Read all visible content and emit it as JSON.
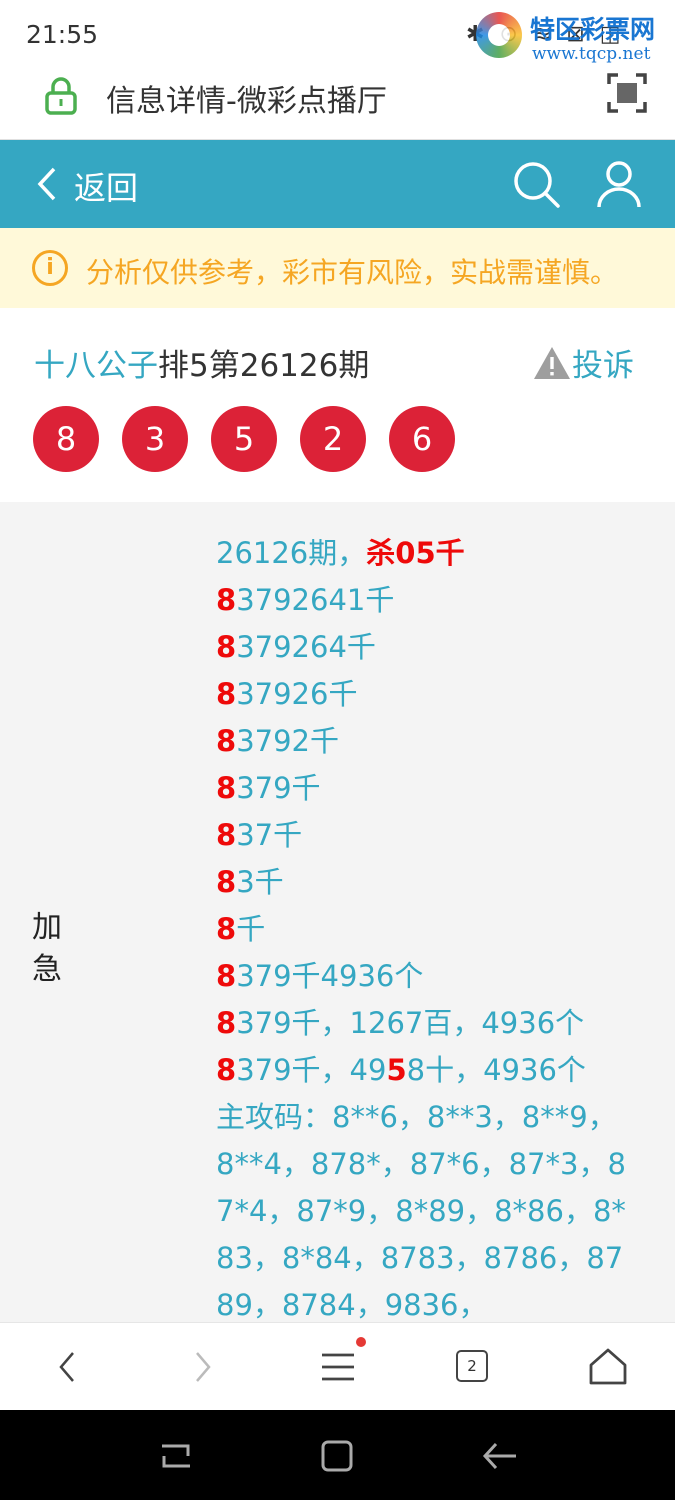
{
  "status_bar": {
    "time": "21:55",
    "icons": "✱ ⊙ ≋ ⊠ ◫"
  },
  "watermark": {
    "title": "特区彩票网",
    "url": "www.tqcp.net"
  },
  "address_bar": {
    "title": "信息详情-微彩点播厅"
  },
  "header": {
    "back_label": "返回"
  },
  "notice": {
    "text": "分析仅供参考，彩市有风险，实战需谨慎。"
  },
  "issue": {
    "author": "十八公子",
    "title_rest": "排5第26126期",
    "report_label": "投诉",
    "balls": [
      "8",
      "3",
      "5",
      "2",
      "6"
    ]
  },
  "content": {
    "side_label": "加急",
    "lines": [
      [
        {
          "t": "26126期，",
          "h": false
        },
        {
          "t": "杀05千",
          "h": true
        }
      ],
      [
        {
          "t": "8",
          "h": true
        },
        {
          "t": "3792641千",
          "h": false
        }
      ],
      [
        {
          "t": "8",
          "h": true
        },
        {
          "t": "379264千",
          "h": false
        }
      ],
      [
        {
          "t": "8",
          "h": true
        },
        {
          "t": "37926千",
          "h": false
        }
      ],
      [
        {
          "t": "8",
          "h": true
        },
        {
          "t": "3792千",
          "h": false
        }
      ],
      [
        {
          "t": "8",
          "h": true
        },
        {
          "t": "379千",
          "h": false
        }
      ],
      [
        {
          "t": "8",
          "h": true
        },
        {
          "t": "37千",
          "h": false
        }
      ],
      [
        {
          "t": "8",
          "h": true
        },
        {
          "t": "3千",
          "h": false
        }
      ],
      [
        {
          "t": "8",
          "h": true
        },
        {
          "t": "千",
          "h": false
        }
      ],
      [
        {
          "t": "8",
          "h": true
        },
        {
          "t": "379千4936个",
          "h": false
        }
      ],
      [
        {
          "t": "8",
          "h": true
        },
        {
          "t": "379千，1267百，4936个",
          "h": false
        }
      ],
      [
        {
          "t": "8",
          "h": true
        },
        {
          "t": "379千，49",
          "h": false
        },
        {
          "t": "5",
          "h": true
        },
        {
          "t": "8十，4936个",
          "h": false
        }
      ],
      [
        {
          "t": "主攻码：8**6，8**3，8**9，",
          "h": false
        }
      ],
      [
        {
          "t": "8**4，878*，87*6，87*3，8",
          "h": false
        }
      ],
      [
        {
          "t": "7*4，87*9，8*89，8*86，8*",
          "h": false
        }
      ],
      [
        {
          "t": "83，8*84，8783，8786，87",
          "h": false
        }
      ],
      [
        {
          "t": "89，8784，9836，",
          "h": false
        }
      ]
    ]
  },
  "browser_nav": {
    "tab_count": "2"
  },
  "colors": {
    "accent": "#35a7c2",
    "ball": "#dc2237",
    "notice": "#f5a623",
    "highlight": "#ee0a0a"
  }
}
